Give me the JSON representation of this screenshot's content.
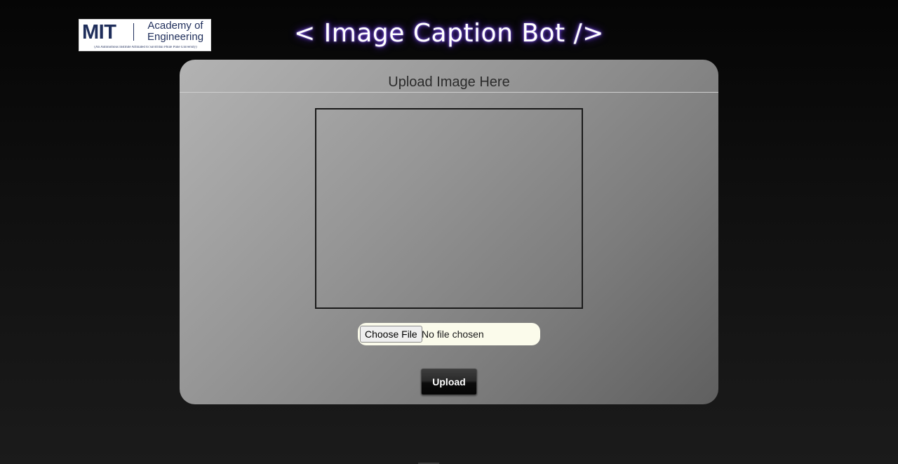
{
  "logo": {
    "mit": "MIT",
    "name_line1": "Academy of",
    "name_line2": "Engineering",
    "subtitle": "(An Autonomous Institute Affiliated to Savitribai Phule Pune University)"
  },
  "header": {
    "title": "< Image Caption Bot />"
  },
  "card": {
    "heading": "Upload Image Here",
    "file_input": {
      "button_label": "Choose File",
      "status": "No file chosen"
    },
    "upload_label": "Upload"
  },
  "colors": {
    "title_glow": "#6a3fd8",
    "logo_blue": "#1f2e5b",
    "file_input_bg": "#fbfbeb"
  }
}
